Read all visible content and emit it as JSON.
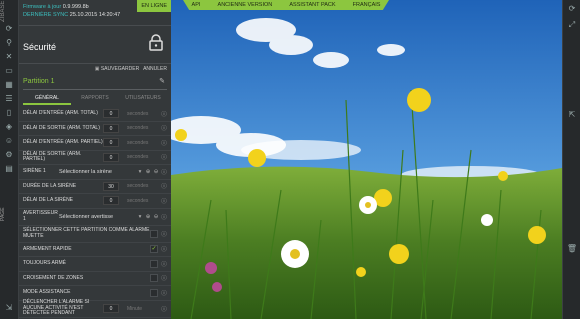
{
  "app": {
    "brand": "ZIBASE"
  },
  "left_rail": {
    "label": "PAGE"
  },
  "firmware": {
    "fw_label": "Firmware à jour",
    "fw_value": "0.9.999.8b",
    "sync_label": "DERNIÈRE SYNC",
    "sync_value": "25.10.2015 14:20:47",
    "status": "EN LIGNE"
  },
  "topnav": [
    "API",
    "ANCIENNE VERSION",
    "ASSISTANT PACK",
    "FRANÇAIS"
  ],
  "section": {
    "title": "Sécurité",
    "save_label": "SAUVEGARDER",
    "cancel_label": "ANNULER"
  },
  "partition": {
    "name": "Partition 1"
  },
  "tabs": [
    "GÉNÉRAL",
    "RAPPORTS",
    "UTILISATEURS"
  ],
  "rows": [
    {
      "label": "DÉLAI D'ENTRÉE (ARM. TOTAL)",
      "value": "0",
      "unit": "secondes"
    },
    {
      "label": "DÉLAI DE SORTIE (ARM. TOTAL)",
      "value": "0",
      "unit": "secondes"
    },
    {
      "label": "DÉLAI D'ENTRÉE (ARM. PARTIEL)",
      "value": "0",
      "unit": "secondes"
    },
    {
      "label": "DÉLAI DE SORTIE (ARM. PARTIEL)",
      "value": "0",
      "unit": "secondes"
    }
  ],
  "siren": {
    "label": "SIRÈNE 1",
    "select": "Sélectionner la sirène"
  },
  "siren_rows": [
    {
      "label": "DURÉE DE LA SIRÈNE",
      "value": "30",
      "unit": "secondes"
    },
    {
      "label": "DÉLAI DE LA SIRÈNE",
      "value": "0",
      "unit": "secondes"
    }
  ],
  "warner": {
    "label": "AVERTISSEUR 1",
    "select": "Sélectionner avertisse"
  },
  "toggles": [
    {
      "label": "SÉLECTIONNER CETTE PARTITION COMME ALARME MUETTE",
      "checked": false
    },
    {
      "label": "ARMEMENT RAPIDE",
      "checked": true
    },
    {
      "label": "TOUJOURS ARMÉ",
      "checked": false
    },
    {
      "label": "CROISEMENT DE ZONES",
      "checked": false
    },
    {
      "label": "MODE ASSISTANCE",
      "checked": false
    }
  ],
  "last_row": {
    "label": "DÉCLENCHER L'ALARME SI AUCUNE ACTIVITÉ N'EST DÉTECTÉE PENDANT",
    "value": "0",
    "unit": "Minute"
  },
  "colors": {
    "accent": "#8cc63f",
    "panel": "#34383a",
    "rail": "#26292b"
  }
}
